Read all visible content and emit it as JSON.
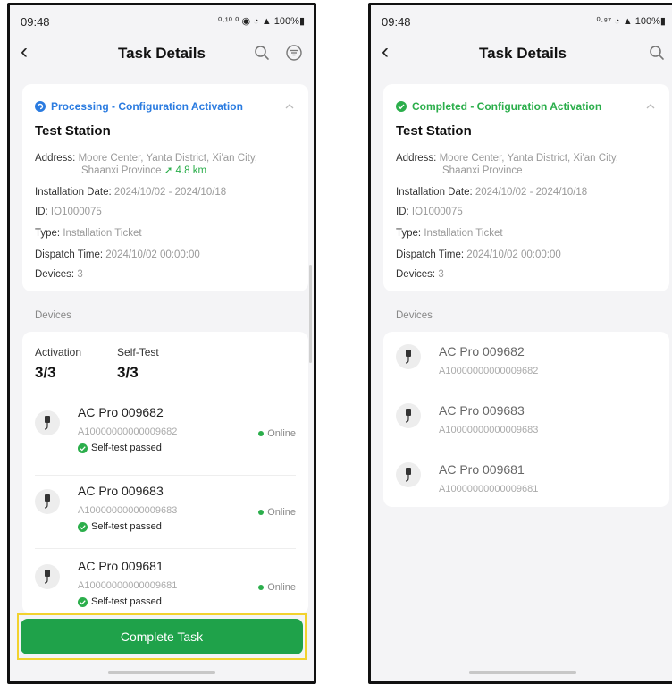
{
  "screens": [
    {
      "status_bar": {
        "time": "09:48",
        "indicators": "⁰·¹⁰ ⁰ ◉ ◔ ▲ 100%▮"
      },
      "appbar": {
        "title": "Task Details"
      },
      "info": {
        "status": "Processing - Configuration Activation",
        "status_color": "#2a7be0",
        "station": "Test Station",
        "address_label": "Address:",
        "address": "Moore Center, Yanta District, Xi'an City,",
        "address2": "Shaanxi Province",
        "distance": "4.8 km",
        "install_label": "Installation Date:",
        "install": "2024/10/02 - 2024/10/18",
        "id_label": "ID:",
        "id": "IO1000075",
        "type_label": "Type:",
        "type": "Installation Ticket",
        "dispatch_label": "Dispatch Time:",
        "dispatch": "2024/10/02 00:00:00",
        "devices_label": "Devices:",
        "devices": "3"
      },
      "devices_header": "Devices",
      "counters": {
        "activation_label": "Activation",
        "activation": "3/3",
        "selftest_label": "Self-Test",
        "selftest": "3/3"
      },
      "devices": [
        {
          "name": "AC Pro 009682",
          "serial": "A10000000000009682",
          "self": "Self-test passed",
          "status": "Online"
        },
        {
          "name": "AC Pro 009683",
          "serial": "A10000000000009683",
          "self": "Self-test passed",
          "status": "Online"
        },
        {
          "name": "AC Pro 009681",
          "serial": "A10000000000009681",
          "self": "Self-test passed",
          "status": "Online"
        }
      ],
      "complete_button": "Complete Task"
    },
    {
      "status_bar": {
        "time": "09:48",
        "indicators": "⁰·⁸⁷ ◔ ▲ 100%▮"
      },
      "appbar": {
        "title": "Task Details"
      },
      "info": {
        "status": "Completed - Configuration Activation",
        "status_color": "#2bae4b",
        "station": "Test Station",
        "address_label": "Address:",
        "address": "Moore Center, Yanta District, Xi'an City,",
        "address2": "Shaanxi Province",
        "install_label": "Installation Date:",
        "install": "2024/10/02 - 2024/10/18",
        "id_label": "ID:",
        "id": "IO1000075",
        "type_label": "Type:",
        "type": "Installation Ticket",
        "dispatch_label": "Dispatch Time:",
        "dispatch": "2024/10/02 00:00:00",
        "devices_label": "Devices:",
        "devices": "3"
      },
      "devices_header": "Devices",
      "devices": [
        {
          "name": "AC Pro 009682",
          "serial": "A10000000000009682"
        },
        {
          "name": "AC Pro 009683",
          "serial": "A10000000000009683"
        },
        {
          "name": "AC Pro 009681",
          "serial": "A10000000000009681"
        }
      ]
    }
  ]
}
